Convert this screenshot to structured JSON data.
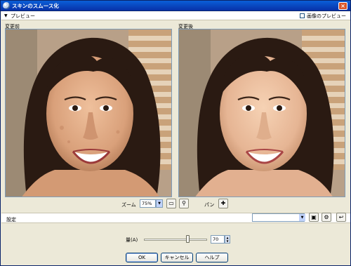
{
  "window": {
    "title": "スキンのスムース化"
  },
  "preview": {
    "section_label": "プレビュー",
    "image_preview_label": "画像のプレビュー"
  },
  "panes": {
    "before_label": "変更前",
    "after_label": "変更後"
  },
  "zoom": {
    "label": "ズーム",
    "value": "75%"
  },
  "pan": {
    "label": "パン"
  },
  "settings": {
    "label": "設定",
    "value": ""
  },
  "amount": {
    "label": "量(A)",
    "value": "70",
    "slider_fraction": 0.7
  },
  "buttons": {
    "ok": "OK",
    "cancel": "キャンセル",
    "help": "ヘルプ"
  },
  "colors": {
    "title_bar": "#0a5fd8",
    "dialog_bg": "#ece9d8",
    "border": "#7f9db9"
  }
}
